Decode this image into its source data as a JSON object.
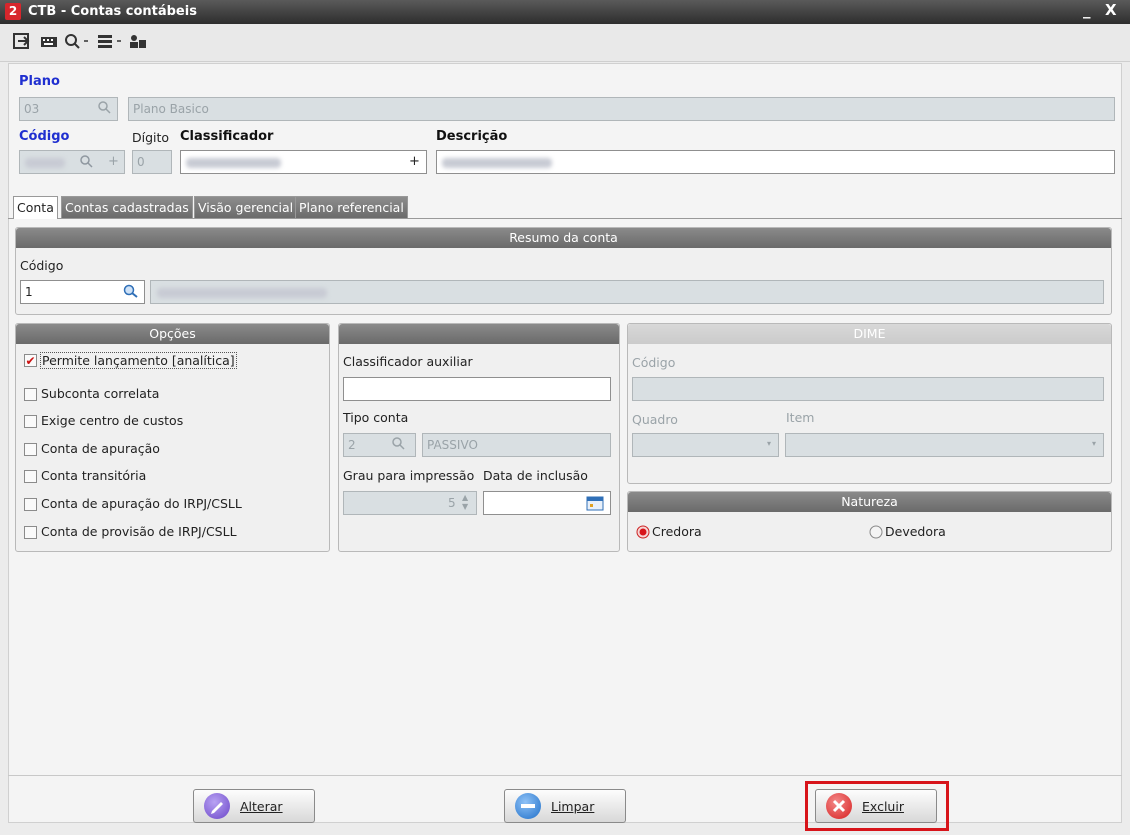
{
  "window": {
    "title": "CTB - Contas contábeis",
    "logo": "2",
    "minimize": "_",
    "close": "X"
  },
  "toolbar": {
    "icons": [
      "export-icon",
      "keyboard-icon",
      "search-icon",
      "list-icon",
      "users-icon"
    ]
  },
  "header": {
    "plano_label": "Plano",
    "plano_code": "03",
    "plano_name": "Plano Basico",
    "codigo_label": "Código",
    "digito_label": "Dígito",
    "digito_value": "0",
    "classificador_label": "Classificador",
    "descricao_label": "Descrição",
    "plus": "+"
  },
  "tabs": [
    "Conta",
    "Contas cadastradas",
    "Visão gerencial",
    "Plano referencial"
  ],
  "resumo": {
    "title": "Resumo da conta",
    "codigo_label": "Código",
    "codigo_value": "1"
  },
  "opcoes": {
    "title": "Opções",
    "items": [
      {
        "label": "Permite lançamento [analítica]",
        "checked": true
      },
      {
        "label": "Subconta correlata",
        "checked": false
      },
      {
        "label": "Exige centro de custos",
        "checked": false
      },
      {
        "label": "Conta de apuração",
        "checked": false
      },
      {
        "label": "Conta transitória",
        "checked": false
      },
      {
        "label": "Conta de apuração do IRPJ/CSLL",
        "checked": false
      },
      {
        "label": "Conta de provisão de IRPJ/CSLL",
        "checked": false
      }
    ]
  },
  "middle": {
    "class_aux_label": "Classificador auxiliar",
    "tipo_label": "Tipo conta",
    "tipo_code": "2",
    "tipo_name": "PASSIVO",
    "grau_label": "Grau para impressão",
    "grau_value": "5",
    "data_label": "Data de inclusão"
  },
  "dime": {
    "title": "DIME",
    "codigo_label": "Código",
    "quadro_label": "Quadro",
    "item_label": "Item"
  },
  "natureza": {
    "title": "Natureza",
    "credora": "Credora",
    "devedora": "Devedora",
    "selected": "Credora"
  },
  "buttons": {
    "alterar": "Alterar",
    "limpar": "Limpar",
    "excluir": "Excluir"
  },
  "colors": {
    "highlight": "#d7141a",
    "accent_blue": "#1f2fd0"
  }
}
